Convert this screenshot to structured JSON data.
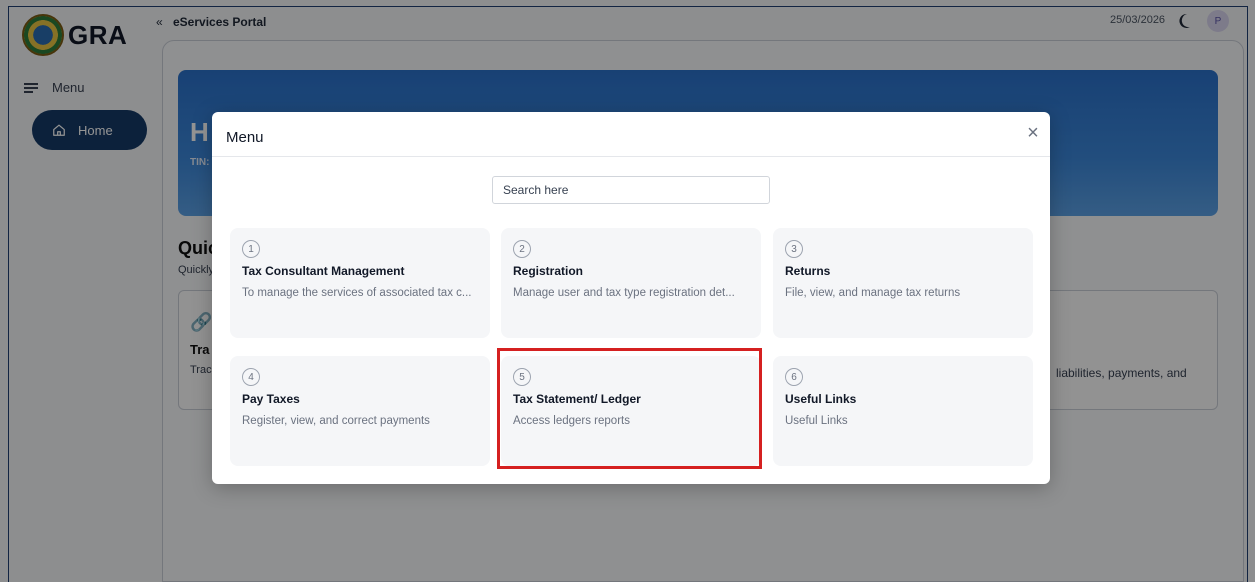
{
  "brand": {
    "logo_text": "GRA"
  },
  "sidebar": {
    "menu_label": "Menu",
    "items": [
      {
        "label": "Home",
        "icon": "home-icon",
        "active": true
      }
    ]
  },
  "topbar": {
    "collapse_glyph": "«",
    "title": "eServices Portal",
    "date": "25/03/2026",
    "avatar_initial": "P"
  },
  "background": {
    "hero_title": "H",
    "hero_sub": "TIN:",
    "quick_title": "Quic",
    "quick_sub": "Quickly",
    "card_icon_glyph": "🔗",
    "card_title": "Tra",
    "card_desc": "Trac",
    "card_desc_right": "liabilities, payments, and"
  },
  "modal": {
    "title": "Menu",
    "close_glyph": "×",
    "search_placeholder": "Search here",
    "tiles": [
      {
        "num": "1",
        "title": "Tax Consultant Management",
        "desc": "To manage the services of associated tax c..."
      },
      {
        "num": "2",
        "title": "Registration",
        "desc": "Manage user and tax type registration det..."
      },
      {
        "num": "3",
        "title": "Returns",
        "desc": "File, view, and manage tax returns"
      },
      {
        "num": "4",
        "title": "Pay Taxes",
        "desc": "Register, view, and correct payments"
      },
      {
        "num": "5",
        "title": "Tax Statement/ Ledger",
        "desc": "Access ledgers reports",
        "highlighted": true
      },
      {
        "num": "6",
        "title": "Useful Links",
        "desc": "Useful Links"
      }
    ]
  },
  "colors": {
    "sidebar_active": "#163a66",
    "highlight": "#d52020",
    "hero": "#2a70c9"
  }
}
